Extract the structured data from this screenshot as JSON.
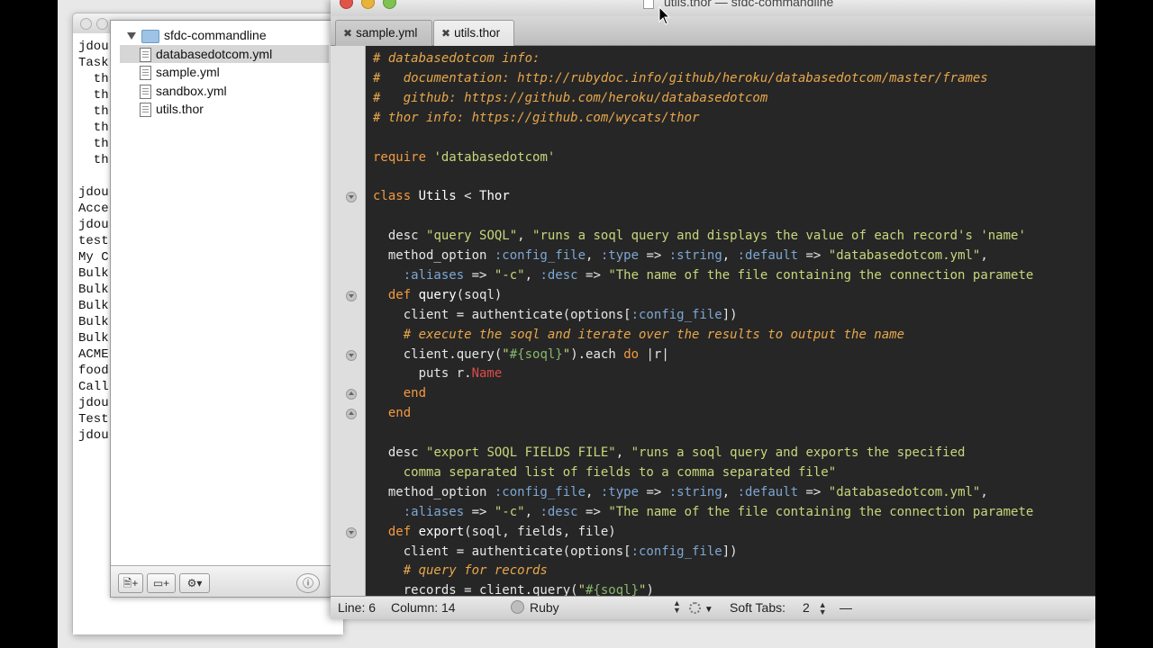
{
  "terminal": {
    "lines": [
      "jdou",
      "Task",
      "  th",
      "  th",
      "  th",
      "  th",
      "  th",
      "  th",
      "",
      "jdou",
      "Acce",
      "jdou",
      "test",
      "My C",
      "Bulk",
      "Bulk",
      "Bulk",
      "Bulk",
      "Bulk",
      "ACME",
      "food",
      "Call",
      "jdou",
      "Test",
      "jdou"
    ]
  },
  "project": {
    "folder": "sfdc-commandline",
    "files": [
      {
        "label": "databasedotcom.yml",
        "selected": true
      },
      {
        "label": "sample.yml",
        "selected": false
      },
      {
        "label": "sandbox.yml",
        "selected": false
      },
      {
        "label": "utils.thor",
        "selected": false
      }
    ],
    "footer": {
      "new_file_icon": "new-file-icon",
      "new_folder_icon": "new-folder-icon",
      "gear_icon": "gear-icon",
      "info_icon": "info-icon"
    }
  },
  "editor": {
    "title": "utils.thor — sfdc-commandline",
    "tabs": [
      {
        "label": "sample.yml",
        "active": false
      },
      {
        "label": "utils.thor",
        "active": true
      }
    ],
    "status": {
      "line": "Line: 6",
      "column": "Column: 14",
      "language": "Ruby",
      "soft_tabs": "Soft Tabs:",
      "tab_size": "2",
      "symbol": "—"
    }
  },
  "code": [
    [
      {
        "t": "# databasedotcom info:",
        "c": "com"
      }
    ],
    [
      {
        "t": "#   documentation: http://rubydoc.info/github/heroku/databasedotcom/master/frames",
        "c": "com"
      }
    ],
    [
      {
        "t": "#   github: https://github.com/heroku/databasedotcom",
        "c": "com"
      }
    ],
    [
      {
        "t": "# thor info: https://github.com/wycats/thor",
        "c": "com"
      }
    ],
    [],
    [
      {
        "t": "require ",
        "c": "kw"
      },
      {
        "t": "'databasedotcom'",
        "c": "str"
      }
    ],
    [],
    [
      {
        "t": "class ",
        "c": "kw"
      },
      {
        "t": "Utils",
        "c": "def"
      },
      {
        "t": " < ",
        "c": ""
      },
      {
        "t": "Thor",
        "c": "def"
      }
    ],
    [],
    [
      {
        "t": "  desc ",
        "c": ""
      },
      {
        "t": "\"query SOQL\"",
        "c": "str"
      },
      {
        "t": ", ",
        "c": ""
      },
      {
        "t": "\"runs a soql query and displays the value of each record's 'name'",
        "c": "str"
      }
    ],
    [
      {
        "t": "  method_option ",
        "c": ""
      },
      {
        "t": ":config_file",
        "c": "sym"
      },
      {
        "t": ", ",
        "c": ""
      },
      {
        "t": ":type",
        "c": "sym"
      },
      {
        "t": " => ",
        "c": ""
      },
      {
        "t": ":string",
        "c": "sym"
      },
      {
        "t": ", ",
        "c": ""
      },
      {
        "t": ":default",
        "c": "sym"
      },
      {
        "t": " => ",
        "c": ""
      },
      {
        "t": "\"databasedotcom.yml\"",
        "c": "str"
      },
      {
        "t": ",",
        "c": ""
      }
    ],
    [
      {
        "t": "    ",
        "c": ""
      },
      {
        "t": ":aliases",
        "c": "sym"
      },
      {
        "t": " => ",
        "c": ""
      },
      {
        "t": "\"-c\"",
        "c": "str"
      },
      {
        "t": ", ",
        "c": ""
      },
      {
        "t": ":desc",
        "c": "sym"
      },
      {
        "t": " => ",
        "c": ""
      },
      {
        "t": "\"The name of the file containing the connection paramete",
        "c": "str"
      }
    ],
    [
      {
        "t": "  def ",
        "c": "kw"
      },
      {
        "t": "query",
        "c": "def"
      },
      {
        "t": "(soql)",
        "c": ""
      }
    ],
    [
      {
        "t": "    client = authenticate(options[",
        "c": ""
      },
      {
        "t": ":config_file",
        "c": "sym"
      },
      {
        "t": "])",
        "c": ""
      }
    ],
    [
      {
        "t": "    # execute the soql and iterate over the results to output the name",
        "c": "com"
      }
    ],
    [
      {
        "t": "    client.query(",
        "c": ""
      },
      {
        "t": "\"",
        "c": "str"
      },
      {
        "t": "#{soql}",
        "c": "int"
      },
      {
        "t": "\"",
        "c": "str"
      },
      {
        "t": ").each ",
        "c": ""
      },
      {
        "t": "do",
        "c": "kw"
      },
      {
        "t": " |r|",
        "c": ""
      }
    ],
    [
      {
        "t": "      puts r.",
        "c": ""
      },
      {
        "t": "Name",
        "c": "const"
      }
    ],
    [
      {
        "t": "    end",
        "c": "kw"
      }
    ],
    [
      {
        "t": "  end",
        "c": "kw"
      }
    ],
    [],
    [
      {
        "t": "  desc ",
        "c": ""
      },
      {
        "t": "\"export SOQL FIELDS FILE\"",
        "c": "str"
      },
      {
        "t": ", ",
        "c": ""
      },
      {
        "t": "\"runs a soql query and exports the specified",
        "c": "str"
      }
    ],
    [
      {
        "t": "    comma separated list of fields to a comma separated file\"",
        "c": "str"
      }
    ],
    [
      {
        "t": "  method_option ",
        "c": ""
      },
      {
        "t": ":config_file",
        "c": "sym"
      },
      {
        "t": ", ",
        "c": ""
      },
      {
        "t": ":type",
        "c": "sym"
      },
      {
        "t": " => ",
        "c": ""
      },
      {
        "t": ":string",
        "c": "sym"
      },
      {
        "t": ", ",
        "c": ""
      },
      {
        "t": ":default",
        "c": "sym"
      },
      {
        "t": " => ",
        "c": ""
      },
      {
        "t": "\"databasedotcom.yml\"",
        "c": "str"
      },
      {
        "t": ",",
        "c": ""
      }
    ],
    [
      {
        "t": "    ",
        "c": ""
      },
      {
        "t": ":aliases",
        "c": "sym"
      },
      {
        "t": " => ",
        "c": ""
      },
      {
        "t": "\"-c\"",
        "c": "str"
      },
      {
        "t": ", ",
        "c": ""
      },
      {
        "t": ":desc",
        "c": "sym"
      },
      {
        "t": " => ",
        "c": ""
      },
      {
        "t": "\"The name of the file containing the connection paramete",
        "c": "str"
      }
    ],
    [
      {
        "t": "  def ",
        "c": "kw"
      },
      {
        "t": "export",
        "c": "def"
      },
      {
        "t": "(soql, fields, file)",
        "c": ""
      }
    ],
    [
      {
        "t": "    client = authenticate(options[",
        "c": ""
      },
      {
        "t": ":config_file",
        "c": "sym"
      },
      {
        "t": "])",
        "c": ""
      }
    ],
    [
      {
        "t": "    # query for records",
        "c": "com"
      }
    ],
    [
      {
        "t": "    records = client.query(",
        "c": ""
      },
      {
        "t": "\"",
        "c": "str"
      },
      {
        "t": "#{soql}",
        "c": "int"
      },
      {
        "t": "\"",
        "c": "str"
      },
      {
        "t": ")",
        "c": ""
      }
    ]
  ],
  "fold_markers": [
    {
      "line": 8,
      "dir": "down"
    },
    {
      "line": 13,
      "dir": "down"
    },
    {
      "line": 16,
      "dir": "down"
    },
    {
      "line": 18,
      "dir": "up"
    },
    {
      "line": 19,
      "dir": "up"
    },
    {
      "line": 25,
      "dir": "down"
    }
  ],
  "colors": {
    "comment": "#e7a74b",
    "keyword": "#f29a3f",
    "string": "#c6d77c",
    "symbol": "#7da7d3",
    "constant": "#e04a4a",
    "background": "#262626"
  }
}
